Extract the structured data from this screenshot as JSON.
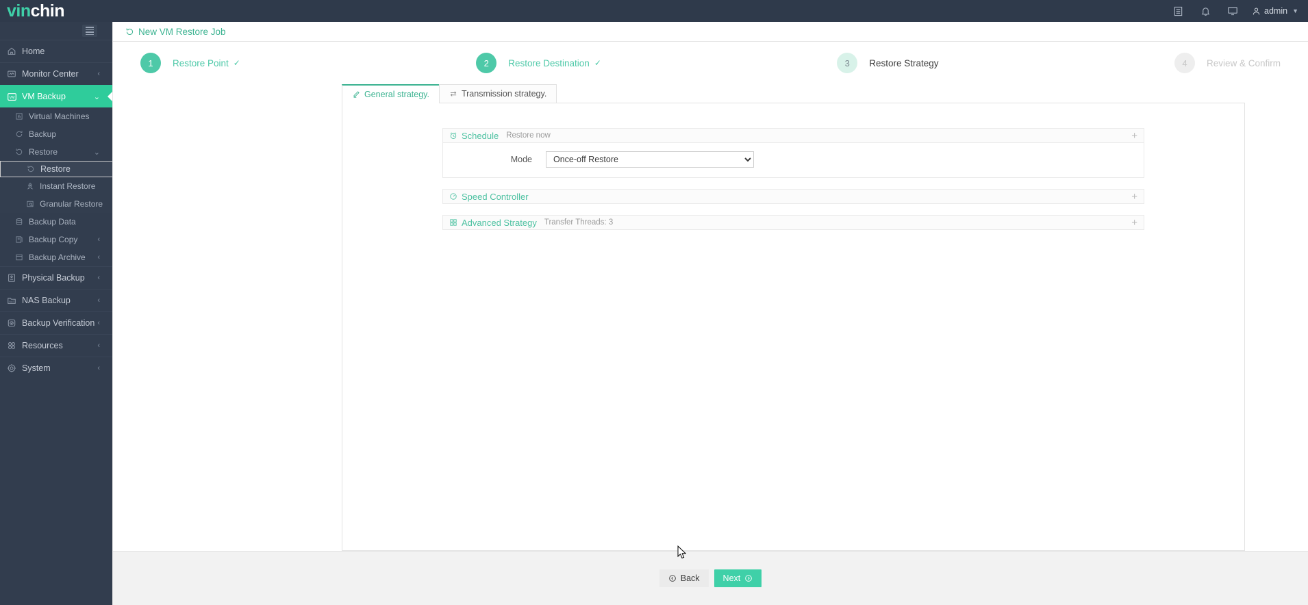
{
  "brand": {
    "part1": "vin",
    "part2": "chin"
  },
  "topbar": {
    "icons": [
      {
        "name": "log-icon",
        "label": ""
      },
      {
        "name": "bell-icon",
        "label": ""
      },
      {
        "name": "monitor-icon",
        "label": ""
      }
    ],
    "user": "admin"
  },
  "sidebar": {
    "items": [
      {
        "label": "Home",
        "icon": "home-icon",
        "type": "top",
        "arrow": "",
        "state": ""
      },
      {
        "label": "Monitor Center",
        "icon": "monitor-center-icon",
        "type": "top",
        "arrow": "‹",
        "state": ""
      },
      {
        "label": "VM Backup",
        "icon": "vm-icon",
        "type": "top",
        "arrow": "⌄",
        "state": "active"
      },
      {
        "label": "Virtual Machines",
        "icon": "chart-icon",
        "type": "sub1",
        "arrow": "",
        "state": ""
      },
      {
        "label": "Backup",
        "icon": "backup-icon",
        "type": "sub1",
        "arrow": "",
        "state": ""
      },
      {
        "label": "Restore",
        "icon": "restore-icon",
        "type": "sub1",
        "arrow": "⌄",
        "state": ""
      },
      {
        "label": "Restore",
        "icon": "restore-icon",
        "type": "sub2",
        "arrow": "",
        "state": "selected"
      },
      {
        "label": "Instant Restore",
        "icon": "rocket-icon",
        "type": "sub2",
        "arrow": "",
        "state": ""
      },
      {
        "label": "Granular Restore",
        "icon": "granular-icon",
        "type": "sub2",
        "arrow": "",
        "state": ""
      },
      {
        "label": "Backup Data",
        "icon": "database-icon",
        "type": "sub1",
        "arrow": "",
        "state": ""
      },
      {
        "label": "Backup Copy",
        "icon": "copy-icon",
        "type": "sub1",
        "arrow": "‹",
        "state": ""
      },
      {
        "label": "Backup Archive",
        "icon": "archive-icon",
        "type": "sub1",
        "arrow": "‹",
        "state": ""
      },
      {
        "label": "Physical Backup",
        "icon": "server-icon",
        "type": "top",
        "arrow": "‹",
        "state": ""
      },
      {
        "label": "NAS Backup",
        "icon": "nas-icon",
        "type": "top",
        "arrow": "‹",
        "state": ""
      },
      {
        "label": "Backup Verification",
        "icon": "verify-icon",
        "type": "top",
        "arrow": "‹",
        "state": ""
      },
      {
        "label": "Resources",
        "icon": "resources-icon",
        "type": "top",
        "arrow": "‹",
        "state": ""
      },
      {
        "label": "System",
        "icon": "gear-icon",
        "type": "top",
        "arrow": "‹",
        "state": ""
      }
    ]
  },
  "page": {
    "title": "New VM Restore Job",
    "icon": "restore-icon"
  },
  "steps": [
    {
      "num": "1",
      "label": "Restore Point",
      "state": "done",
      "check": "✓"
    },
    {
      "num": "2",
      "label": "Restore Destination",
      "state": "done",
      "check": "✓"
    },
    {
      "num": "3",
      "label": "Restore Strategy",
      "state": "current",
      "check": ""
    },
    {
      "num": "4",
      "label": "Review & Confirm",
      "state": "todo",
      "check": ""
    }
  ],
  "tabs": [
    {
      "label": "General strategy.",
      "icon": "pencil-icon",
      "active": true
    },
    {
      "label": "Transmission strategy.",
      "icon": "transfer-icon",
      "active": false
    }
  ],
  "panels": {
    "schedule": {
      "title": "Schedule",
      "subtitle": "Restore now",
      "icon": "alarm-clock-icon",
      "plus": "+",
      "mode_label": "Mode",
      "mode_value": "Once-off Restore",
      "mode_options": [
        "Once-off Restore"
      ]
    },
    "speed": {
      "title": "Speed Controller",
      "subtitle": "",
      "icon": "gauge-icon",
      "plus": "+"
    },
    "advanced": {
      "title": "Advanced Strategy",
      "subtitle": "Transfer Threads: 3",
      "icon": "grid-icon",
      "plus": "+"
    }
  },
  "footer": {
    "back_label": "Back",
    "next_label": "Next"
  },
  "colors": {
    "accent": "#3fd0a8",
    "accent_text": "#3cb391",
    "sidebar_bg": "#323d4e",
    "topbar_bg": "#2f3a4b",
    "footer_bg": "#f2f2f2"
  }
}
